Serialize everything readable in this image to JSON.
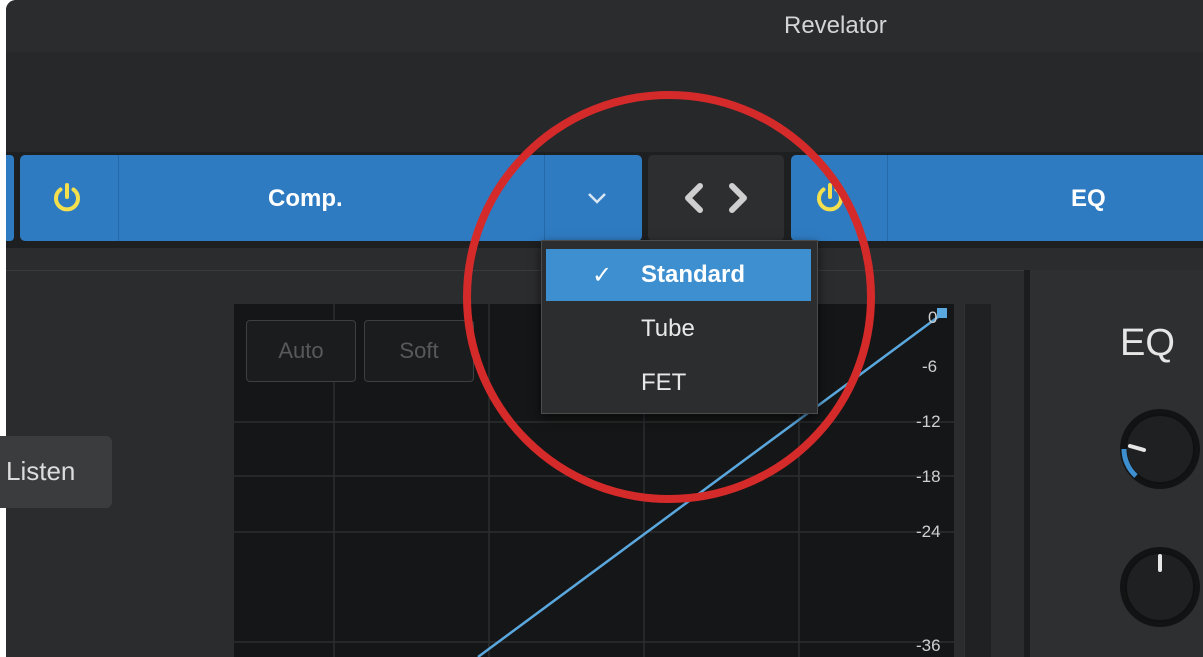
{
  "window": {
    "title": "Revelator"
  },
  "tabs": [
    {
      "label": "Comp.",
      "power_icon": "power-icon",
      "dropdown_icon": "chevron-down-icon"
    },
    {
      "label": "EQ",
      "power_icon": "power-icon"
    }
  ],
  "nav": {
    "icon": "code-brackets-icon",
    "glyph": "< >"
  },
  "compressor": {
    "buttons": {
      "auto_label": "Auto",
      "soft_label": "Soft",
      "listen_label": "Listen"
    },
    "db_scale": [
      "0",
      "-6",
      "-12",
      "-18",
      "-24",
      "-36"
    ]
  },
  "eq_panel": {
    "title": "EQ"
  },
  "dropdown": {
    "options": [
      {
        "label": "Standard",
        "checked": true,
        "check_mark": "✓"
      },
      {
        "label": "Tube",
        "checked": false
      },
      {
        "label": "FET",
        "checked": false
      }
    ]
  },
  "colors": {
    "accent": "#2f7bc2",
    "power": "#f4e04d",
    "highlight": "#d42a2a",
    "curve": "#5ba8de"
  }
}
